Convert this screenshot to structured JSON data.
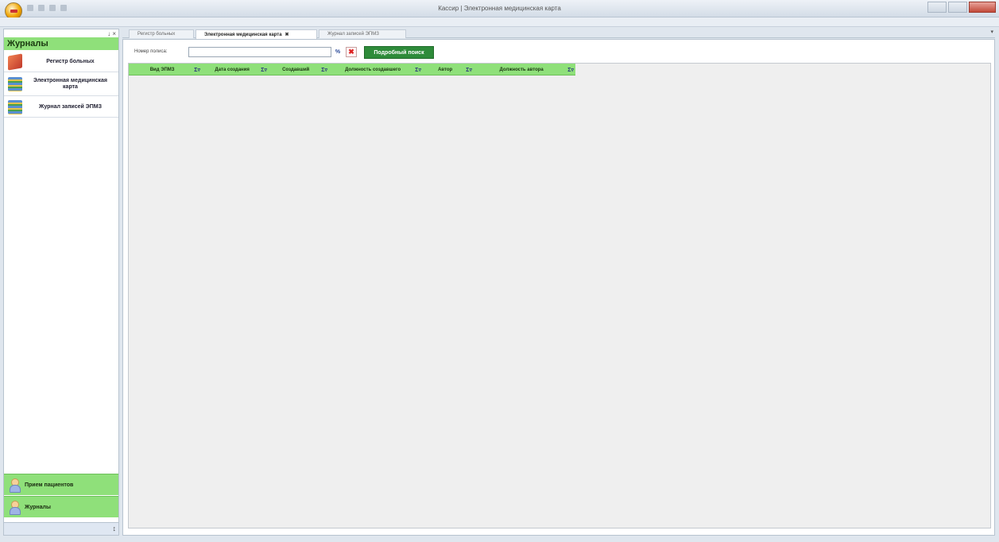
{
  "window": {
    "title": "Кассир | Электронная медицинская карта"
  },
  "sidebar": {
    "header": "Журналы",
    "tools": "↓ ×",
    "items": [
      {
        "label": "Регистр больных",
        "icon": "book-red-icon"
      },
      {
        "label": "Электронная медицинская карта",
        "icon": "stack-icon"
      },
      {
        "label": "Журнал записей ЭПМЗ",
        "icon": "stack-icon"
      }
    ],
    "bottom_buttons": [
      {
        "label": "Прием пациентов",
        "icon": "person-icon"
      },
      {
        "label": "Журналы",
        "icon": "person-icon"
      }
    ],
    "scroll_glyph": "↕"
  },
  "tabs": [
    {
      "label": "Регистр больных",
      "active": false
    },
    {
      "label": "Электронная медицинская карта",
      "active": true,
      "close": "✖"
    },
    {
      "label": "Журнал записей ЭПМЗ",
      "active": false
    }
  ],
  "tabbar_arrow": "▾",
  "search": {
    "label": "Номер полиса:",
    "value": "",
    "percent_label": "%",
    "clear_label": "✖",
    "detail_button": "Подробный поиск"
  },
  "grid": {
    "columns": [
      {
        "label": "Вид ЭПМЗ",
        "icons": "Σ▿"
      },
      {
        "label": "Дата создания",
        "icons": "Σ▿"
      },
      {
        "label": "Создавший",
        "icons": "Σ▿"
      },
      {
        "label": "Должность создавшего",
        "icons": "Σ▿"
      },
      {
        "label": "Автор",
        "icons": "Σ▿"
      },
      {
        "label": "Должность автора",
        "icons": "Σ▿"
      }
    ],
    "rows": []
  },
  "colors": {
    "accent_green": "#8fe07a",
    "button_green": "#2e8b3a"
  }
}
